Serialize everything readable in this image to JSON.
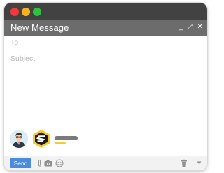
{
  "compose": {
    "title": "New Message",
    "controls": {
      "minimize": "_",
      "expand": "⤢",
      "close": "✕"
    }
  },
  "fields": {
    "to_placeholder": "To",
    "subject_placeholder": "Subject"
  },
  "signature": {
    "logo_colors": [
      "#f4cb2c",
      "#1a1a1a"
    ],
    "name_bar_color": "#7a7a7a",
    "accent_bar_color": "#f4cb2c"
  },
  "toolbar": {
    "send_label": "Send",
    "icons": [
      "paperclip-icon",
      "camera-icon",
      "smiley-icon",
      "trash-icon",
      "chevron-down-icon"
    ]
  },
  "colors": {
    "titlebar": "#424242",
    "compose_header": "#6c6c6c",
    "send_button": "#4a8be0",
    "traffic_red": "#ee3a3c",
    "traffic_yellow": "#f6b321",
    "traffic_green": "#2fc241"
  }
}
